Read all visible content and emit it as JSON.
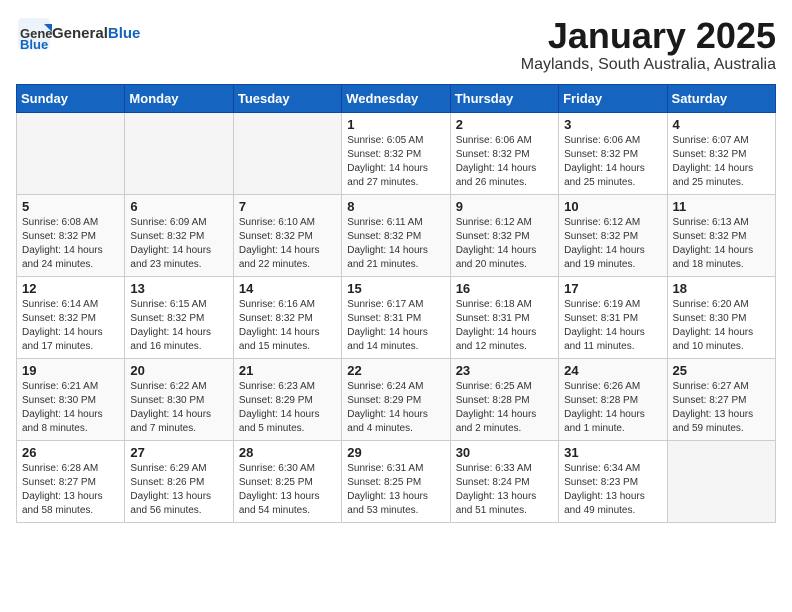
{
  "header": {
    "logo_general": "General",
    "logo_blue": "Blue",
    "title": "January 2025",
    "subtitle": "Maylands, South Australia, Australia"
  },
  "days_of_week": [
    "Sunday",
    "Monday",
    "Tuesday",
    "Wednesday",
    "Thursday",
    "Friday",
    "Saturday"
  ],
  "weeks": [
    [
      {
        "day": "",
        "info": ""
      },
      {
        "day": "",
        "info": ""
      },
      {
        "day": "",
        "info": ""
      },
      {
        "day": "1",
        "info": "Sunrise: 6:05 AM\nSunset: 8:32 PM\nDaylight: 14 hours\nand 27 minutes."
      },
      {
        "day": "2",
        "info": "Sunrise: 6:06 AM\nSunset: 8:32 PM\nDaylight: 14 hours\nand 26 minutes."
      },
      {
        "day": "3",
        "info": "Sunrise: 6:06 AM\nSunset: 8:32 PM\nDaylight: 14 hours\nand 25 minutes."
      },
      {
        "day": "4",
        "info": "Sunrise: 6:07 AM\nSunset: 8:32 PM\nDaylight: 14 hours\nand 25 minutes."
      }
    ],
    [
      {
        "day": "5",
        "info": "Sunrise: 6:08 AM\nSunset: 8:32 PM\nDaylight: 14 hours\nand 24 minutes."
      },
      {
        "day": "6",
        "info": "Sunrise: 6:09 AM\nSunset: 8:32 PM\nDaylight: 14 hours\nand 23 minutes."
      },
      {
        "day": "7",
        "info": "Sunrise: 6:10 AM\nSunset: 8:32 PM\nDaylight: 14 hours\nand 22 minutes."
      },
      {
        "day": "8",
        "info": "Sunrise: 6:11 AM\nSunset: 8:32 PM\nDaylight: 14 hours\nand 21 minutes."
      },
      {
        "day": "9",
        "info": "Sunrise: 6:12 AM\nSunset: 8:32 PM\nDaylight: 14 hours\nand 20 minutes."
      },
      {
        "day": "10",
        "info": "Sunrise: 6:12 AM\nSunset: 8:32 PM\nDaylight: 14 hours\nand 19 minutes."
      },
      {
        "day": "11",
        "info": "Sunrise: 6:13 AM\nSunset: 8:32 PM\nDaylight: 14 hours\nand 18 minutes."
      }
    ],
    [
      {
        "day": "12",
        "info": "Sunrise: 6:14 AM\nSunset: 8:32 PM\nDaylight: 14 hours\nand 17 minutes."
      },
      {
        "day": "13",
        "info": "Sunrise: 6:15 AM\nSunset: 8:32 PM\nDaylight: 14 hours\nand 16 minutes."
      },
      {
        "day": "14",
        "info": "Sunrise: 6:16 AM\nSunset: 8:32 PM\nDaylight: 14 hours\nand 15 minutes."
      },
      {
        "day": "15",
        "info": "Sunrise: 6:17 AM\nSunset: 8:31 PM\nDaylight: 14 hours\nand 14 minutes."
      },
      {
        "day": "16",
        "info": "Sunrise: 6:18 AM\nSunset: 8:31 PM\nDaylight: 14 hours\nand 12 minutes."
      },
      {
        "day": "17",
        "info": "Sunrise: 6:19 AM\nSunset: 8:31 PM\nDaylight: 14 hours\nand 11 minutes."
      },
      {
        "day": "18",
        "info": "Sunrise: 6:20 AM\nSunset: 8:30 PM\nDaylight: 14 hours\nand 10 minutes."
      }
    ],
    [
      {
        "day": "19",
        "info": "Sunrise: 6:21 AM\nSunset: 8:30 PM\nDaylight: 14 hours\nand 8 minutes."
      },
      {
        "day": "20",
        "info": "Sunrise: 6:22 AM\nSunset: 8:30 PM\nDaylight: 14 hours\nand 7 minutes."
      },
      {
        "day": "21",
        "info": "Sunrise: 6:23 AM\nSunset: 8:29 PM\nDaylight: 14 hours\nand 5 minutes."
      },
      {
        "day": "22",
        "info": "Sunrise: 6:24 AM\nSunset: 8:29 PM\nDaylight: 14 hours\nand 4 minutes."
      },
      {
        "day": "23",
        "info": "Sunrise: 6:25 AM\nSunset: 8:28 PM\nDaylight: 14 hours\nand 2 minutes."
      },
      {
        "day": "24",
        "info": "Sunrise: 6:26 AM\nSunset: 8:28 PM\nDaylight: 14 hours\nand 1 minute."
      },
      {
        "day": "25",
        "info": "Sunrise: 6:27 AM\nSunset: 8:27 PM\nDaylight: 13 hours\nand 59 minutes."
      }
    ],
    [
      {
        "day": "26",
        "info": "Sunrise: 6:28 AM\nSunset: 8:27 PM\nDaylight: 13 hours\nand 58 minutes."
      },
      {
        "day": "27",
        "info": "Sunrise: 6:29 AM\nSunset: 8:26 PM\nDaylight: 13 hours\nand 56 minutes."
      },
      {
        "day": "28",
        "info": "Sunrise: 6:30 AM\nSunset: 8:25 PM\nDaylight: 13 hours\nand 54 minutes."
      },
      {
        "day": "29",
        "info": "Sunrise: 6:31 AM\nSunset: 8:25 PM\nDaylight: 13 hours\nand 53 minutes."
      },
      {
        "day": "30",
        "info": "Sunrise: 6:33 AM\nSunset: 8:24 PM\nDaylight: 13 hours\nand 51 minutes."
      },
      {
        "day": "31",
        "info": "Sunrise: 6:34 AM\nSunset: 8:23 PM\nDaylight: 13 hours\nand 49 minutes."
      },
      {
        "day": "",
        "info": ""
      }
    ]
  ]
}
